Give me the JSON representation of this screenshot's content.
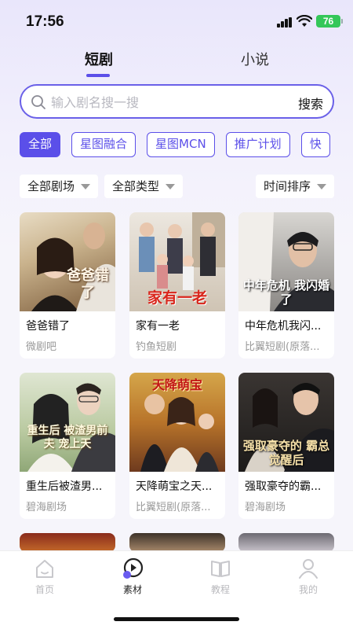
{
  "status": {
    "time": "17:56",
    "battery": "76"
  },
  "top_tabs": [
    {
      "label": "短剧",
      "active": true
    },
    {
      "label": "小说",
      "active": false
    }
  ],
  "search": {
    "placeholder": "输入剧名搜一搜",
    "button": "搜索"
  },
  "chips": [
    {
      "label": "全部",
      "active": true
    },
    {
      "label": "星图融合",
      "active": false
    },
    {
      "label": "星图MCN",
      "active": false
    },
    {
      "label": "推广计划",
      "active": false
    },
    {
      "label": "快",
      "active": false
    }
  ],
  "filters": {
    "theater": "全部剧场",
    "type": "全部类型",
    "sort": "时间排序"
  },
  "dramas": [
    {
      "title": "爸爸错了",
      "source": "微剧吧",
      "poster_text": "爸爸错了"
    },
    {
      "title": "家有一老",
      "source": "钓鱼短剧",
      "poster_text": "家有一老"
    },
    {
      "title": "中年危机我闪...",
      "source": "比翼短剧(原落...",
      "poster_text": "中年危机 我闪婚了"
    },
    {
      "title": "重生后被渣男...",
      "source": "碧海剧场",
      "poster_text": "重生后 被渣男前夫 宠上天"
    },
    {
      "title": "天降萌宝之天...",
      "source": "比翼短剧(原落...",
      "poster_text": "天降萌宝"
    },
    {
      "title": "强取豪夺的霸...",
      "source": "碧海剧场",
      "poster_text": "强取豪夺的 霸总觉醒后"
    }
  ],
  "bottom_nav": [
    {
      "label": "首页",
      "icon": "home-icon",
      "active": false
    },
    {
      "label": "素材",
      "icon": "play-icon",
      "active": true
    },
    {
      "label": "教程",
      "icon": "book-icon",
      "active": false
    },
    {
      "label": "我的",
      "icon": "user-icon",
      "active": false
    }
  ],
  "colors": {
    "accent": "#5b4fe9",
    "battery": "#34c759"
  }
}
